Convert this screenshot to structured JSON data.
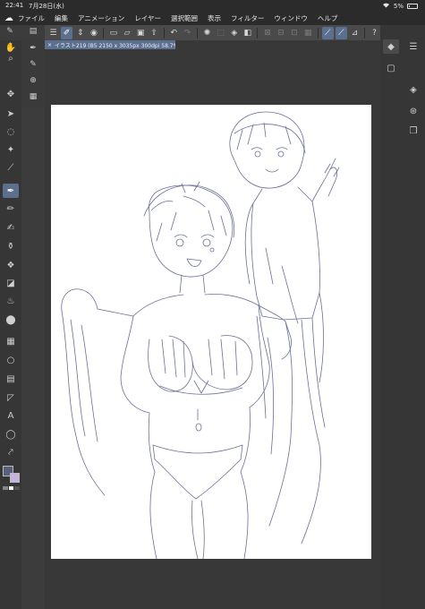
{
  "status_bar": {
    "time": "22:41",
    "date": "7月28日(水)",
    "battery": "5%"
  },
  "menu": {
    "logo_icon": "clip-studio-logo-icon",
    "items": [
      "ファイル",
      "編集",
      "アニメーション",
      "レイヤー",
      "選択範囲",
      "表示",
      "フィルター",
      "ウィンドウ",
      "ヘルプ"
    ]
  },
  "document": {
    "tab_title": "イラスト219 (B5 2150 x 3035px 300dpi 58.7%)",
    "close_glyph": "×"
  },
  "colors": {
    "accent": "#5b6f8f",
    "main_color": "#5a5f80",
    "sub_color": "#c4b3dd",
    "ui_background": "#3c3c3c",
    "canvas": "#ffffff",
    "sketch_line": "#6b6f96"
  },
  "toolbar": {
    "icons": [
      "menu-icon",
      "brush-icon",
      "updown-icon",
      "record-icon",
      "new-file-icon",
      "open-folder-icon",
      "save-icon",
      "export-icon",
      "undo-icon",
      "redo-icon",
      "loading-icon",
      "transform-icon",
      "fill-icon",
      "deselect-icon",
      "crop-icon",
      "invert-selection-icon",
      "stroke-selection-icon",
      "ruler-snap-icon",
      "special-ruler-snap-icon",
      "grid-snap-icon",
      "help-icon"
    ]
  },
  "tools": [
    "move-hand-icon",
    "zoom-icon",
    "layer-move-icon",
    "operation-icon",
    "lasso-select-icon",
    "eyedropper-icon",
    "pen-icon",
    "pencil-icon",
    "brush-icon",
    "airbrush-icon",
    "decoration-icon",
    "eraser-icon",
    "blend-icon",
    "fill-bucket-icon",
    "gradient-icon",
    "figure-icon",
    "frame-icon",
    "ruler-icon",
    "text-icon",
    "balloon-icon",
    "correct-line-icon"
  ]
}
